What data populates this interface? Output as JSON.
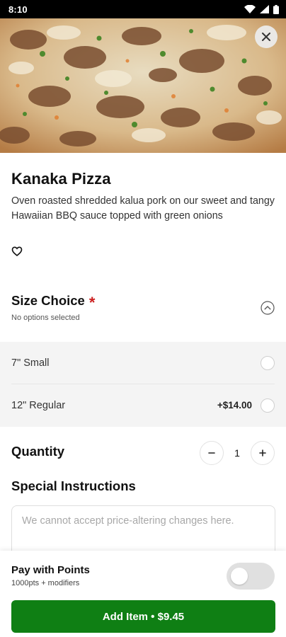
{
  "status_bar": {
    "time": "8:10",
    "icons": [
      "wifi-icon",
      "signal-icon",
      "battery-icon"
    ]
  },
  "hero": {
    "image": "pizza-photo",
    "close_icon": "close-icon"
  },
  "product": {
    "title": "Kanaka Pizza",
    "description": "Oven roasted shredded kalua pork on our sweet and tangy Hawaiian BBQ sauce topped with green onions",
    "favorite_icon": "heart-icon"
  },
  "size_choice": {
    "heading": "Size Choice",
    "required_marker": "*",
    "subtitle": "No options selected",
    "options": [
      {
        "label": "7\" Small",
        "price": ""
      },
      {
        "label": "12\" Regular",
        "price": "+$14.00"
      }
    ]
  },
  "quantity": {
    "label": "Quantity",
    "value": "1",
    "minus": "−",
    "plus": "+"
  },
  "special_instructions": {
    "heading": "Special Instructions",
    "placeholder": "We cannot accept price-altering changes here.",
    "value": ""
  },
  "pay_with_points": {
    "title": "Pay with Points",
    "subtitle": "1000pts + modifiers",
    "enabled": false
  },
  "add_item_button": {
    "label": "Add Item • $9.45"
  },
  "colors": {
    "accent_green": "#0f7f14",
    "required_red": "#cc1f1f",
    "options_bg": "#f4f4f4"
  }
}
